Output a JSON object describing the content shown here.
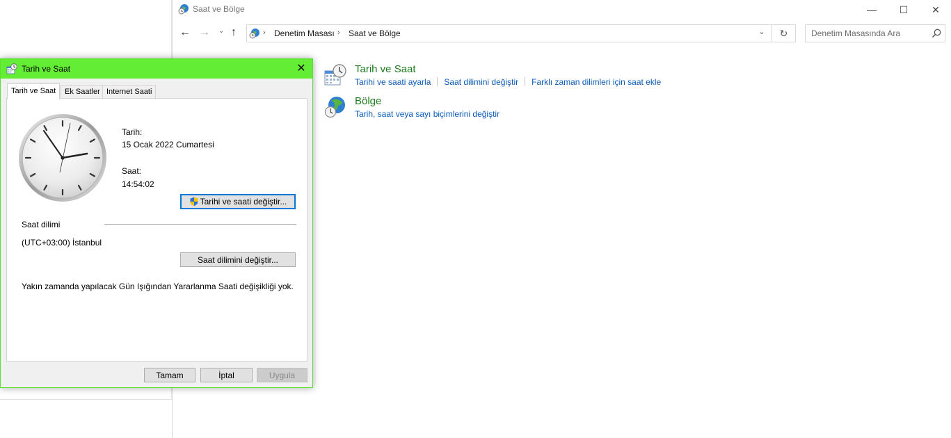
{
  "control_panel": {
    "window_title": "Saat ve Bölge",
    "window_controls": {
      "minimize": "—",
      "maximize": "☐",
      "close": "✕"
    },
    "nav": {
      "back": "←",
      "forward": "→",
      "recent": "⌄",
      "up": "↑"
    },
    "address": {
      "separator": "›",
      "crumbs": [
        "Denetim Masası",
        "Saat ve Bölge"
      ],
      "dropdown": "⌄"
    },
    "refresh": "↻",
    "search_placeholder": "Denetim Masasında Ara",
    "categories": [
      {
        "title": "Tarih ve Saat",
        "icon": "datetime-icon",
        "links": [
          "Tarihi ve saati ayarla",
          "Saat dilimini değiştir",
          "Farklı zaman dilimleri için saat ekle"
        ]
      },
      {
        "title": "Bölge",
        "icon": "region-globe-icon",
        "links": [
          "Tarih, saat veya sayı biçimlerini değiştir"
        ]
      }
    ]
  },
  "dialog": {
    "title": "Tarih ve Saat",
    "close": "✕",
    "tabs": [
      "Tarih ve Saat",
      "Ek Saatler",
      "Internet Saati"
    ],
    "active_tab": "Tarih ve Saat",
    "date_label": "Tarih:",
    "date_value": "15 Ocak 2022 Cumartesi",
    "time_label": "Saat:",
    "time_value": "14:54:02",
    "change_datetime_button": "Tarihi ve saati değiştir...",
    "timezone_section": "Saat dilimi",
    "timezone_value": "(UTC+03:00) İstanbul",
    "change_timezone_button": "Saat dilimini değiştir...",
    "dst_note": "Yakın zamanda yapılacak Gün Işığından Yararlanma Saati değişikliği yok.",
    "buttons": {
      "ok": "Tamam",
      "cancel": "İptal",
      "apply": "Uygula"
    },
    "colors": {
      "titlebar": "#63ee35",
      "border": "#5ae02e"
    }
  },
  "colors": {
    "category_title": "#1e7c1e",
    "link": "#0a5ab8",
    "focus_blue": "#0078d7"
  }
}
